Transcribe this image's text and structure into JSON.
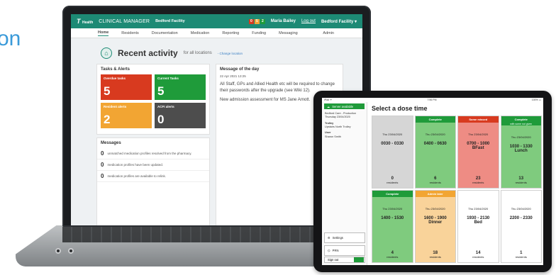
{
  "background_text": "on",
  "laptop": {
    "brand": "Health",
    "app_title": "CLINICAL MANAGER",
    "facility_short": "Bedford Facility",
    "user": "Maria Bailey",
    "logout": "Log out",
    "facility_menu": "Bedford Facility ▾",
    "badges": [
      "0",
      "5",
      "2"
    ],
    "nav": [
      "Home",
      "Residents",
      "Documentation",
      "Medication",
      "Reporting",
      "Funding",
      "Messaging",
      "Admin"
    ],
    "page_title": "Recent activity",
    "page_sub": "for all locations",
    "change_location": "- Change location",
    "tasks_title": "Tasks & Alerts",
    "tiles": [
      {
        "label": "Overdue tasks",
        "value": "5",
        "color": "#d83a1f"
      },
      {
        "label": "Current Tasks",
        "value": "5",
        "color": "#1f9b3a"
      },
      {
        "label": "Resident alerts",
        "value": "2",
        "color": "#f2a533"
      },
      {
        "label": "ACFI alerts",
        "value": "0",
        "color": "#4d4d4d"
      }
    ],
    "messages_title": "Messages",
    "messages": [
      {
        "count": "0",
        "text": "unmatched medication profiles resolved from the pharmacy."
      },
      {
        "count": "0",
        "text": "medication profiles have been updated."
      },
      {
        "count": "0",
        "text": "medication profiles are available to relink."
      }
    ],
    "motd_title": "Message of the day",
    "motd_date": "22 Apr 2021 13:25",
    "motd_p1": "All Staff, GPs and Allied Health etc will be required to change their passwords after the upgrade (see Wiki 12).",
    "motd_p2": "New admission assessment for MS Jane Arnott."
  },
  "tablet": {
    "status_left": "iPad ᯤ",
    "status_mid": "7:56 PM",
    "status_right": "100% ▭",
    "server": "Server available",
    "facility": "Bedford Care - Production",
    "date": "Thursday 23/04/2020",
    "trolley_label": "Trolley",
    "trolley": "Upstairs North Trolley",
    "user_label": "User",
    "user": "Sharon Smith",
    "settings": "Settings",
    "prn": "PRN",
    "signout": "Sign out",
    "title": "Select a dose time",
    "cells": [
      {
        "header": "",
        "header_color": "",
        "bg": "#d6d6d6",
        "date": "Thu 23/04/2020",
        "time": "0030 - 0330",
        "meal": "",
        "count": "0",
        "res": "residents",
        "sub": ""
      },
      {
        "header": "Complete",
        "header_color": "#1f9b3a",
        "bg": "#7fcb7e",
        "date": "Thu 23/04/2020",
        "time": "0400 - 0630",
        "meal": "",
        "count": "6",
        "res": "residents",
        "sub": ""
      },
      {
        "header": "Some missed",
        "header_color": "#d83a1f",
        "bg": "#ee8c84",
        "date": "Thu 23/04/2020",
        "time": "0700 - 1000",
        "meal": "BFast",
        "count": "23",
        "res": "residents",
        "sub": ""
      },
      {
        "header": "Complete",
        "header_color": "#1f9b3a",
        "bg": "#7fcb7e",
        "date": "Thu 23/04/2020",
        "time": "1030 - 1330",
        "meal": "Lunch",
        "count": "13",
        "res": "residents",
        "sub": "with some not given"
      },
      {
        "header": "Complete",
        "header_color": "#1f9b3a",
        "bg": "#7fcb7e",
        "date": "Thu 23/04/2020",
        "time": "1400 - 1530",
        "meal": "",
        "count": "4",
        "res": "residents",
        "sub": ""
      },
      {
        "header": "Admin later",
        "header_color": "#f2a533",
        "bg": "#f9d39a",
        "date": "Thu 23/04/2020",
        "time": "1600 - 1900",
        "meal": "Dinner",
        "count": "18",
        "res": "residents",
        "sub": ""
      },
      {
        "header": "",
        "header_color": "",
        "bg": "#ffffff",
        "date": "Thu 23/04/2020",
        "time": "1930 - 2130",
        "meal": "Bed",
        "count": "14",
        "res": "residents",
        "sub": ""
      },
      {
        "header": "",
        "header_color": "",
        "bg": "#ffffff",
        "date": "Thu 23/04/2020",
        "time": "2200 - 2330",
        "meal": "",
        "count": "1",
        "res": "residents",
        "sub": ""
      }
    ]
  }
}
